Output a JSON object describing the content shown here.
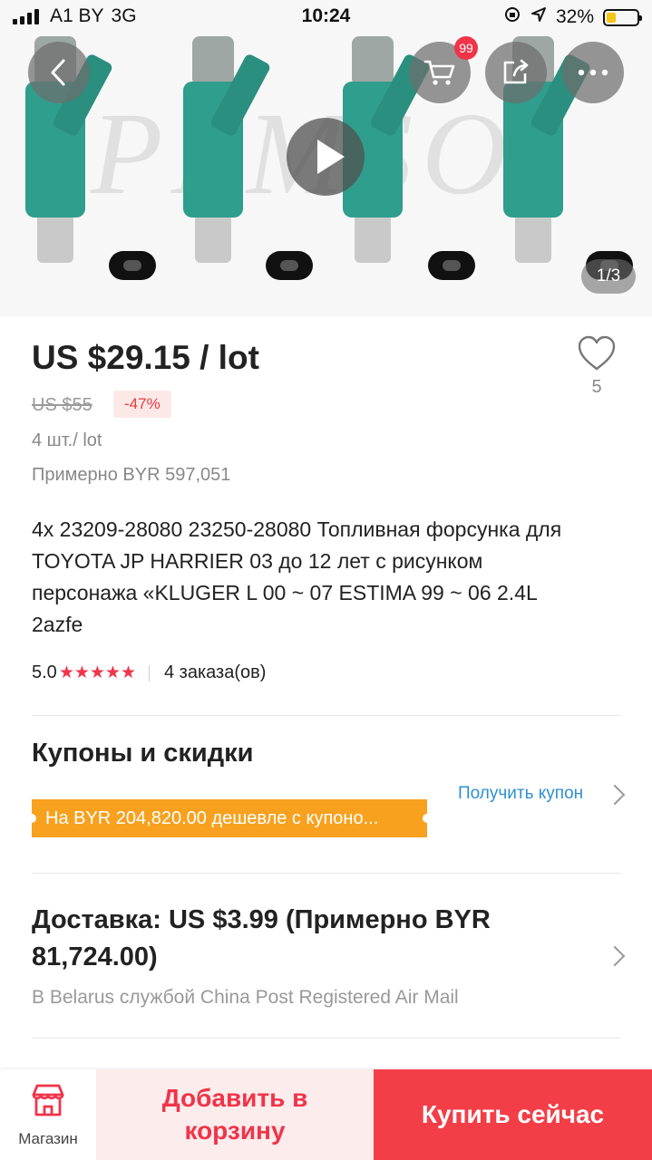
{
  "status_bar": {
    "carrier": "A1 BY",
    "network": "3G",
    "time": "10:24",
    "battery": "32%"
  },
  "gallery": {
    "cart_badge": "99",
    "counter": "1/3"
  },
  "product": {
    "price": "US $29.15 / lot",
    "old_price": "US $55",
    "discount": "-47%",
    "unit": "4 шт./ lot",
    "approx_price": "Примерно BYR 597,051",
    "wishlist_count": "5",
    "title": "4x 23209-28080 23250-28080 Топливная форсунка для TOYOTA JP HARRIER 03 до 12 лет с рисунком персонажа «KLUGER L 00 ~ 07 ESTIMA 99 ~ 06 2.4L 2azfe",
    "rating": "5.0",
    "stars": "★★★★★",
    "orders": "4 заказа(ов)"
  },
  "coupons": {
    "title": "Купоны и скидки",
    "link": "Получить купон",
    "banner": "На BYR 204,820.00 дешевле с купоно..."
  },
  "shipping": {
    "title": "Доставка: US $3.99 (Примерно BYR 81,724.00)",
    "subtitle": "В Belarus службой China Post Registered Air Mail"
  },
  "bottom_bar": {
    "store_label": "Магазин",
    "add_to_cart": "Добавить в корзину",
    "buy_now": "Купить сейчас"
  },
  "colors": {
    "accent_red": "#f33e48",
    "coupon_orange": "#f7a11f",
    "link_blue": "#2f8fd6"
  }
}
